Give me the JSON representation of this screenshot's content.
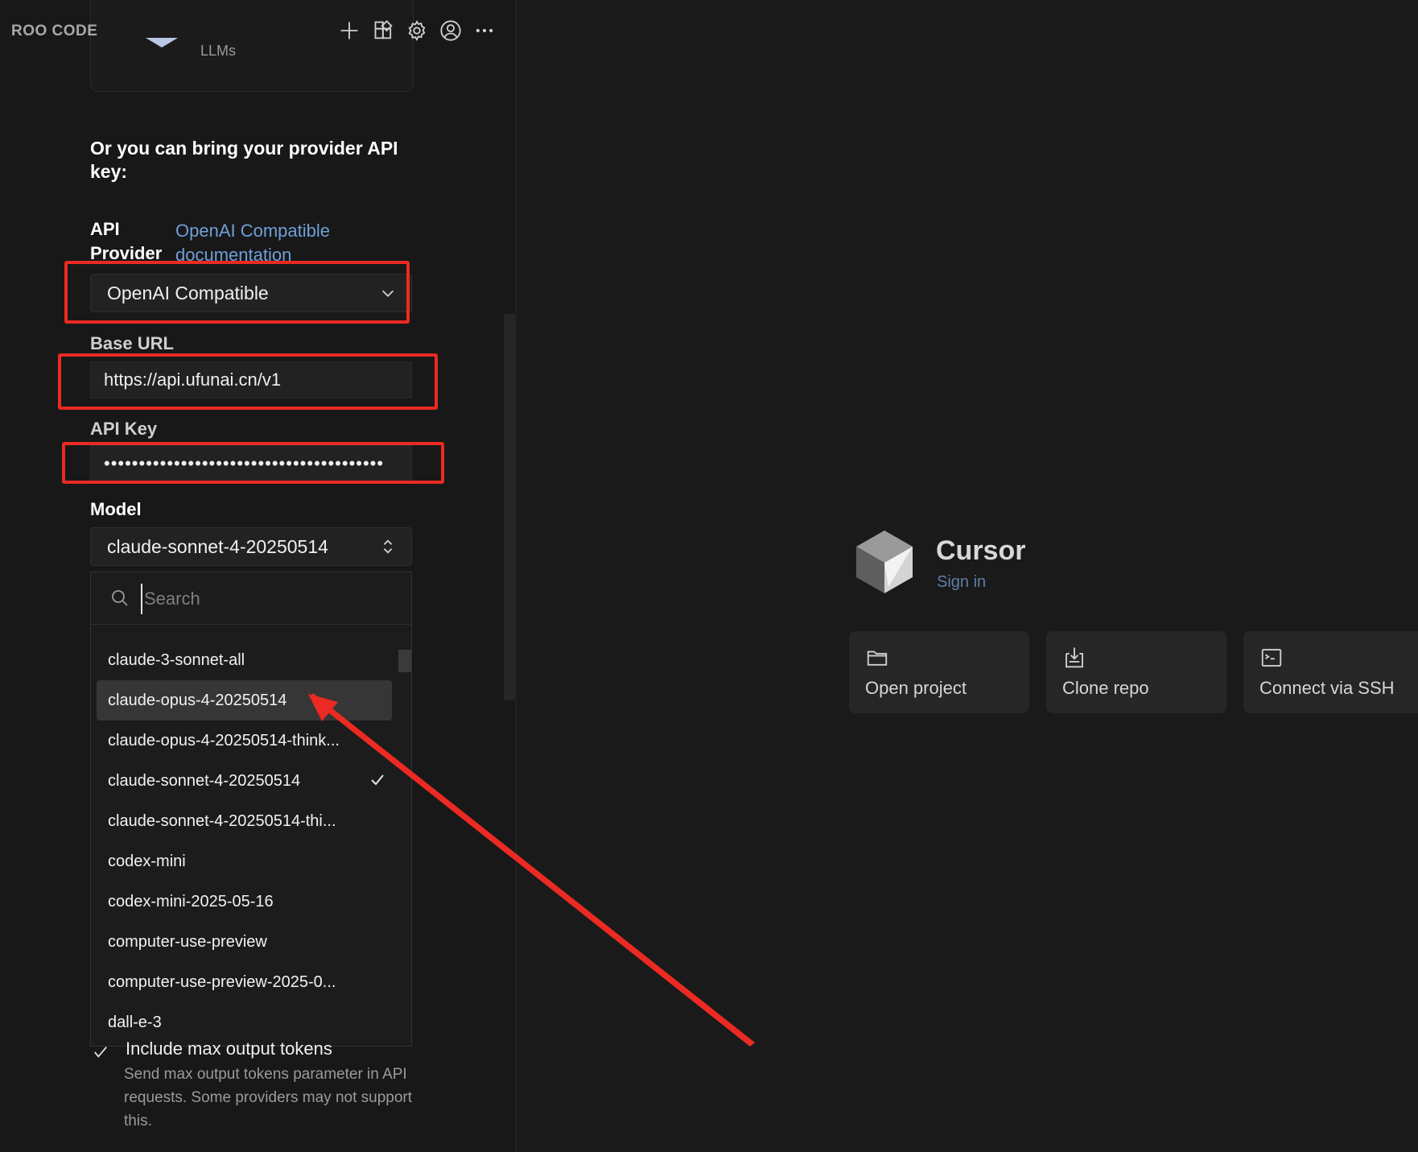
{
  "app": {
    "title": "ROO CODE"
  },
  "toolbar": {
    "icons": [
      "plus-icon",
      "marketplace-icon",
      "gear-icon",
      "account-icon",
      "more-icon"
    ]
  },
  "router_card": {
    "text": "LLMs"
  },
  "byok": {
    "heading": "Or you can bring your provider API key:"
  },
  "provider": {
    "label": "API Provider",
    "doc_link": "OpenAI Compatible documentation",
    "selected": "OpenAI Compatible"
  },
  "base_url": {
    "label": "Base URL",
    "value": "https://api.ufunai.cn/v1"
  },
  "api_key": {
    "label": "API Key",
    "value": "••••••••••••••••••••••••••••••••••••••••"
  },
  "model": {
    "label": "Model",
    "selected": "claude-sonnet-4-20250514",
    "search_placeholder": "Search",
    "options": [
      "claude-3-sonnet-all",
      "claude-opus-4-20250514",
      "claude-opus-4-20250514-think...",
      "claude-sonnet-4-20250514",
      "claude-sonnet-4-20250514-thi...",
      "codex-mini",
      "codex-mini-2025-05-16",
      "computer-use-preview",
      "computer-use-preview-2025-0...",
      "dall-e-3"
    ],
    "highlighted_index": 1,
    "checked_index": 3
  },
  "max_tokens": {
    "label": "Include max output tokens",
    "description": "Send max output tokens parameter in API requests. Some providers may not support this.",
    "checked": true
  },
  "welcome": {
    "title": "Cursor",
    "sign_in": "Sign in",
    "actions": [
      {
        "label": "Open project",
        "icon": "folder-icon"
      },
      {
        "label": "Clone repo",
        "icon": "clone-icon"
      },
      {
        "label": "Connect via SSH",
        "icon": "terminal-icon"
      }
    ]
  },
  "colors": {
    "annotation_red": "#ea2a23",
    "link_blue": "#6f9fd8",
    "background": "#1a1a1a"
  }
}
